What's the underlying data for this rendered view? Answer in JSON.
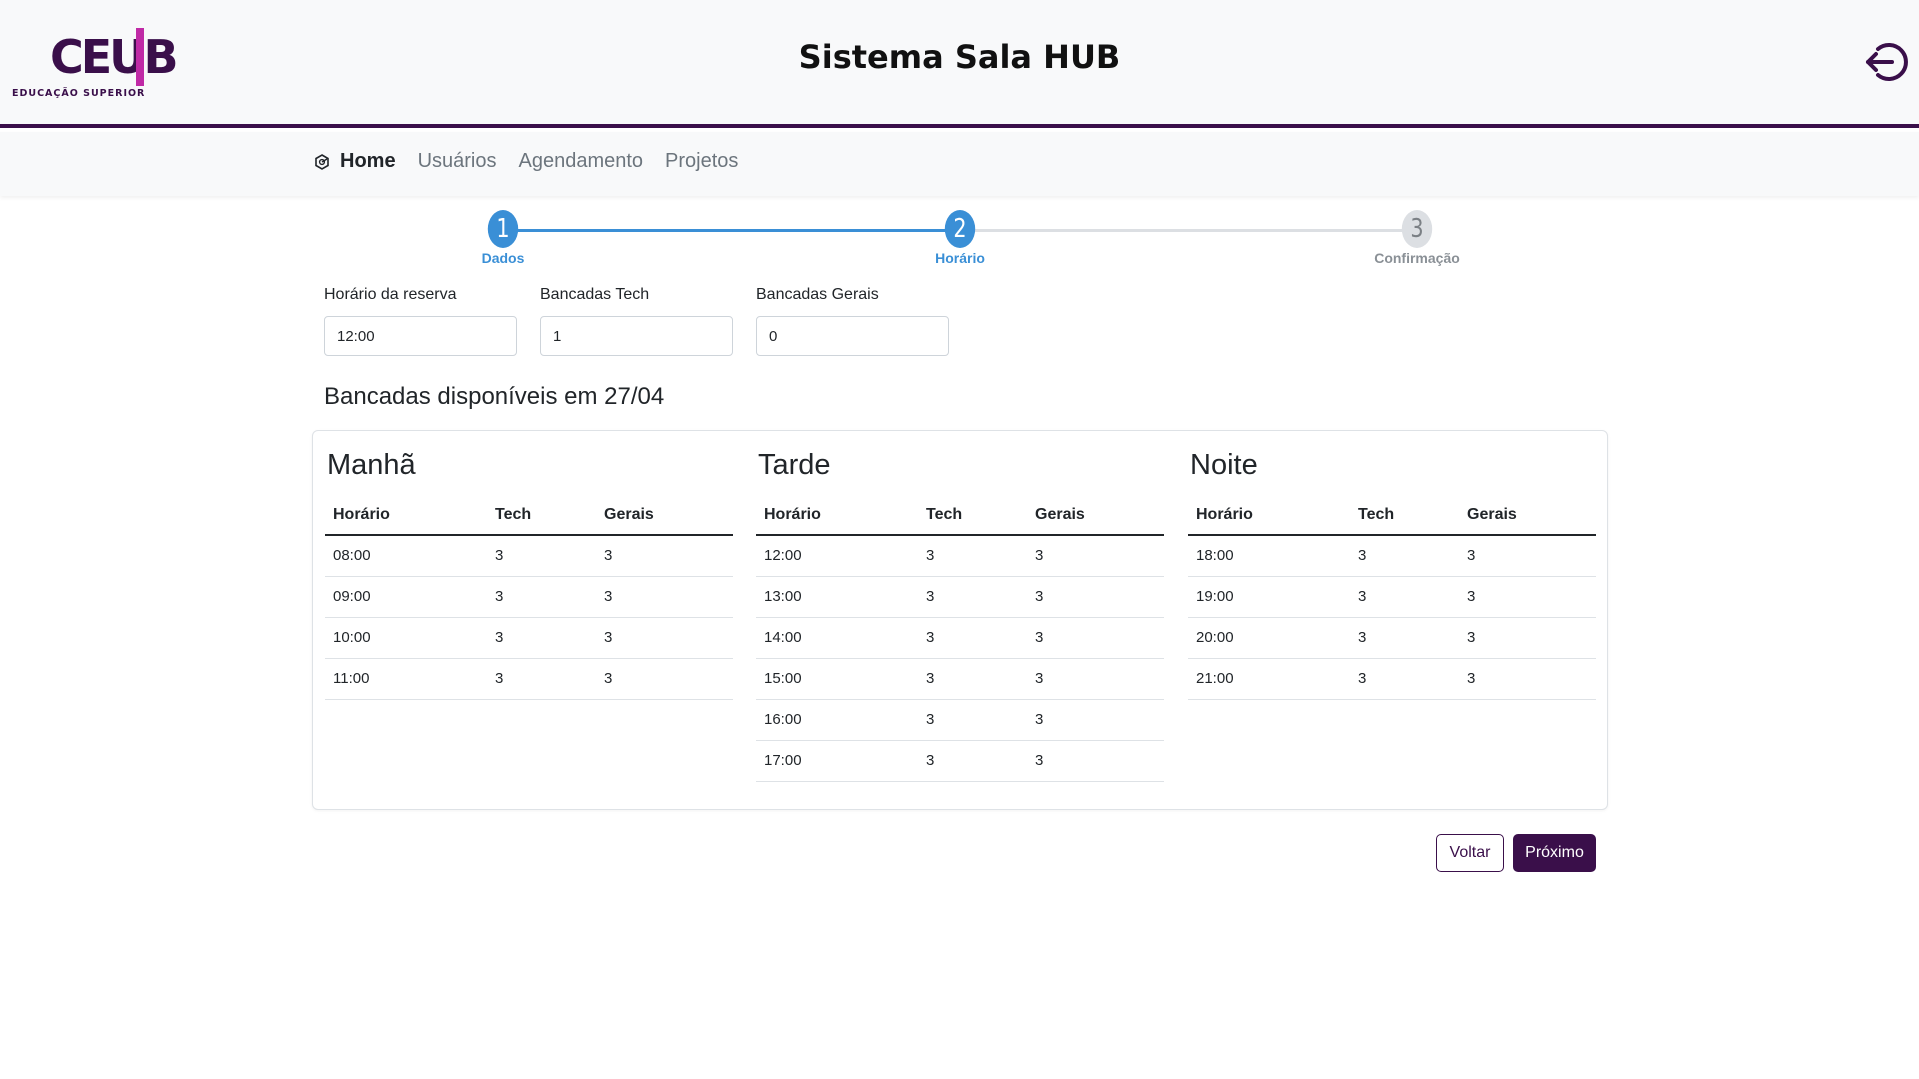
{
  "header": {
    "logo_text": "CEUB",
    "logo_subtitle": "EDUCAÇÃO SUPERIOR",
    "title": "Sistema Sala HUB",
    "logout_icon": "logout-icon"
  },
  "nav": {
    "items": [
      {
        "label": "Home",
        "icon": "home-icon",
        "active": true
      },
      {
        "label": "Usuários",
        "active": false
      },
      {
        "label": "Agendamento",
        "active": false
      },
      {
        "label": "Projetos",
        "active": false
      }
    ]
  },
  "stepper": {
    "current_step": 2,
    "steps": [
      {
        "number": "1",
        "label": "Dados",
        "state": "done"
      },
      {
        "number": "2",
        "label": "Horário",
        "state": "active"
      },
      {
        "number": "3",
        "label": "Confirmação",
        "state": "todo"
      }
    ]
  },
  "form": {
    "horario": {
      "label": "Horário da reserva",
      "value": "12:00"
    },
    "tech": {
      "label": "Bancadas Tech",
      "value": "1"
    },
    "gerais": {
      "label": "Bancadas Gerais",
      "value": "0"
    }
  },
  "availability": {
    "title": "Bancadas disponíveis em 27/04",
    "columns": [
      "Horário",
      "Tech",
      "Gerais"
    ],
    "periods": [
      {
        "name": "Manhã",
        "rows": [
          [
            "08:00",
            "3",
            "3"
          ],
          [
            "09:00",
            "3",
            "3"
          ],
          [
            "10:00",
            "3",
            "3"
          ],
          [
            "11:00",
            "3",
            "3"
          ]
        ]
      },
      {
        "name": "Tarde",
        "rows": [
          [
            "12:00",
            "3",
            "3"
          ],
          [
            "13:00",
            "3",
            "3"
          ],
          [
            "14:00",
            "3",
            "3"
          ],
          [
            "15:00",
            "3",
            "3"
          ],
          [
            "16:00",
            "3",
            "3"
          ],
          [
            "17:00",
            "3",
            "3"
          ]
        ]
      },
      {
        "name": "Noite",
        "rows": [
          [
            "18:00",
            "3",
            "3"
          ],
          [
            "19:00",
            "3",
            "3"
          ],
          [
            "20:00",
            "3",
            "3"
          ],
          [
            "21:00",
            "3",
            "3"
          ]
        ]
      }
    ]
  },
  "actions": {
    "back_label": "Voltar",
    "next_label": "Próximo"
  },
  "colors": {
    "brand": "#3a0f4a",
    "brand_accent": "#c02aa6",
    "step_active": "#3a8fd6",
    "step_inactive": "#dcdfe3"
  }
}
